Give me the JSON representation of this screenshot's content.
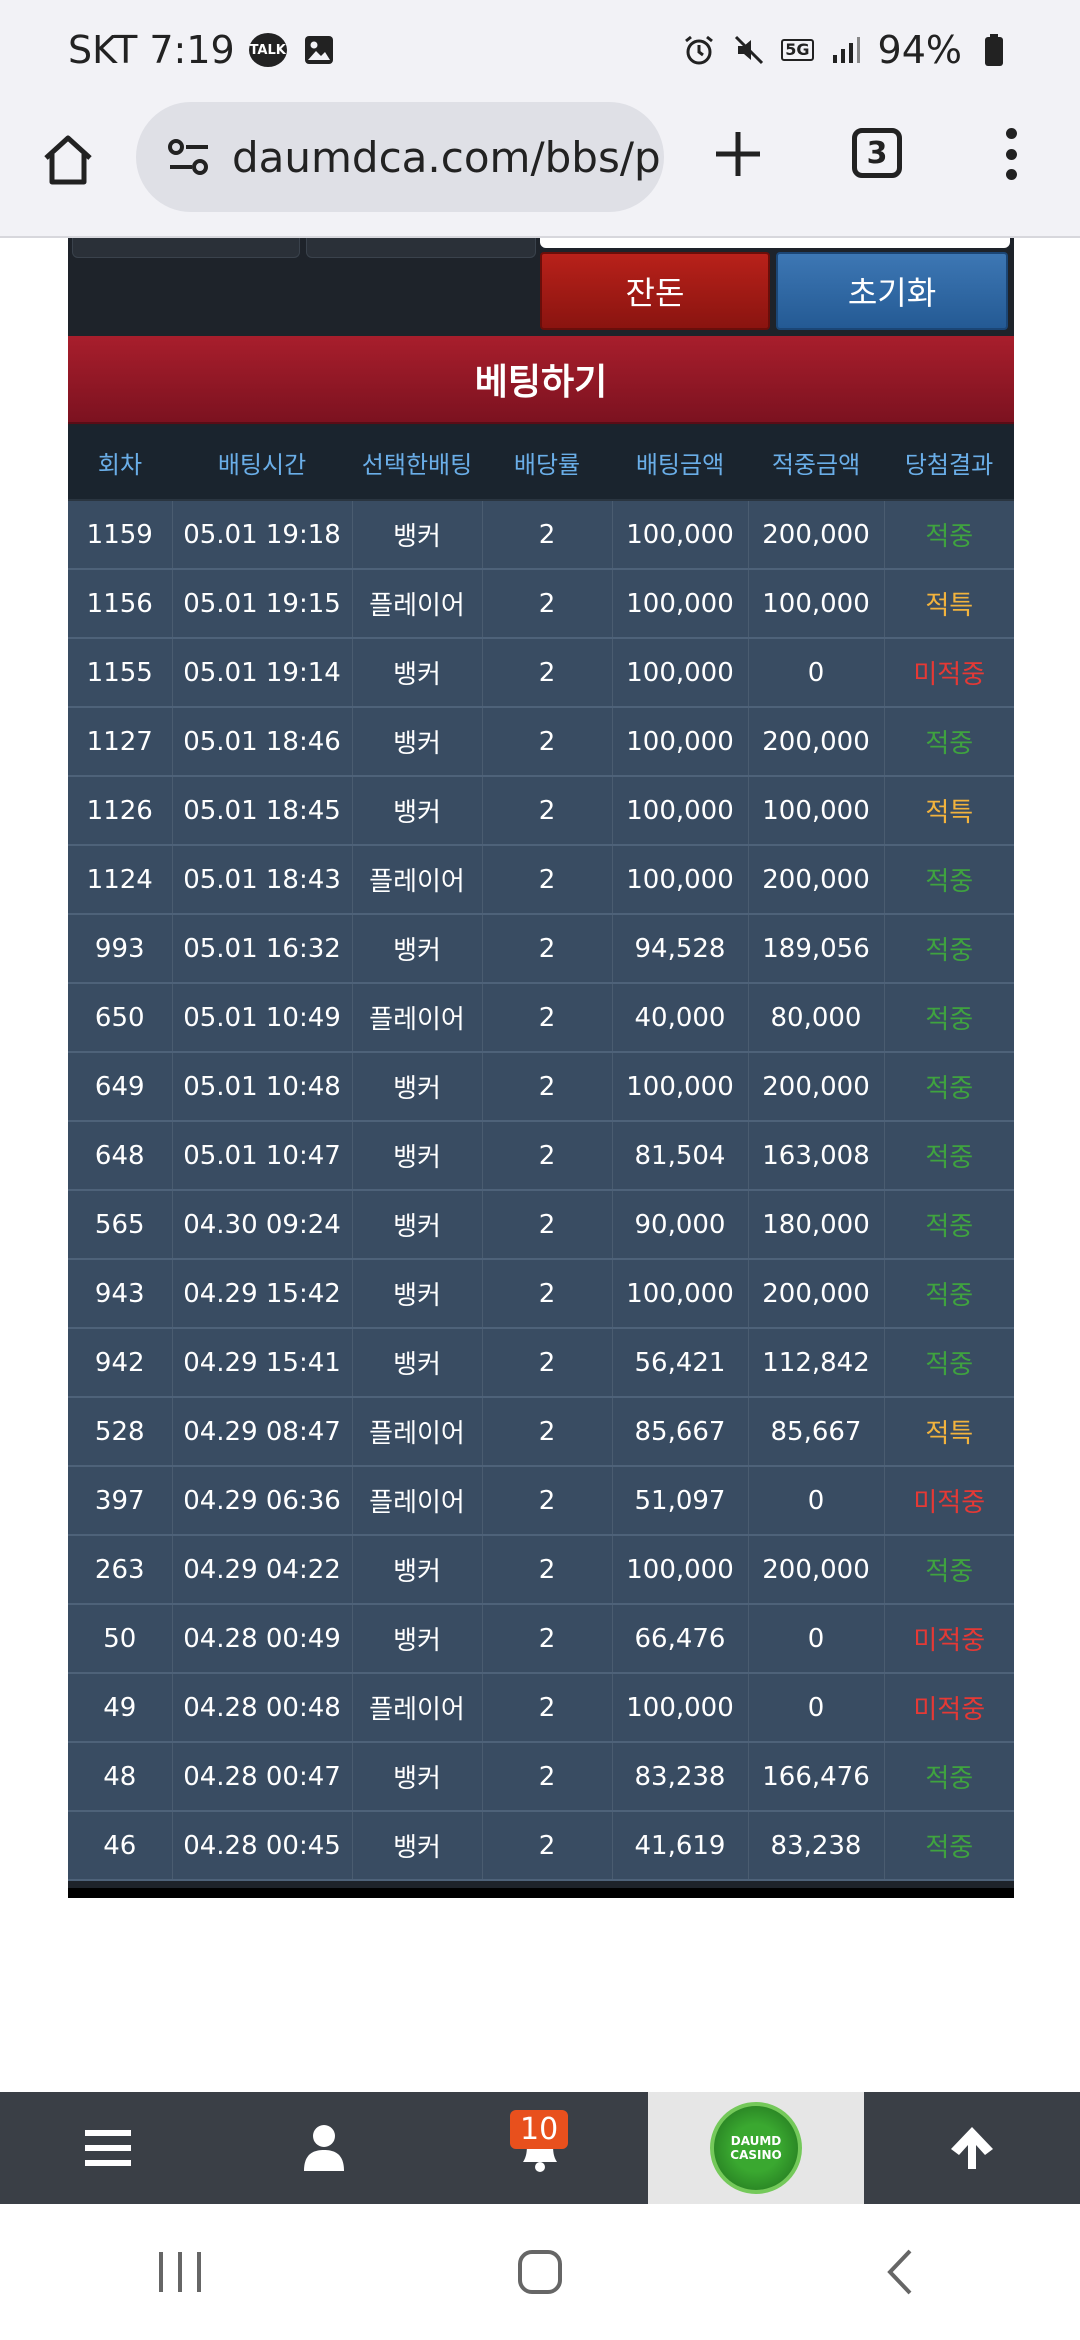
{
  "status_bar": {
    "carrier_time": "SKT 7:19",
    "talk_badge": "TALK",
    "network": "5G",
    "battery": "94%"
  },
  "browser": {
    "url": "daumdca.com/bbs/p",
    "tab_count": "3"
  },
  "panel": {
    "balance_label": "잔돈",
    "reset_label": "초기화",
    "bet_header": "베팅하기"
  },
  "table": {
    "headers": [
      "회차",
      "배팅시간",
      "선택한배팅",
      "배당률",
      "배팅금액",
      "적중금액",
      "당첨결과"
    ],
    "rows": [
      {
        "round": "1159",
        "time": "05.01 19:18",
        "pick": "뱅커",
        "odds": "2",
        "bet": "100,000",
        "payout": "200,000",
        "result": "적중",
        "status": "win"
      },
      {
        "round": "1156",
        "time": "05.01 19:15",
        "pick": "플레이어",
        "odds": "2",
        "bet": "100,000",
        "payout": "100,000",
        "result": "적특",
        "status": "push"
      },
      {
        "round": "1155",
        "time": "05.01 19:14",
        "pick": "뱅커",
        "odds": "2",
        "bet": "100,000",
        "payout": "0",
        "result": "미적중",
        "status": "lose"
      },
      {
        "round": "1127",
        "time": "05.01 18:46",
        "pick": "뱅커",
        "odds": "2",
        "bet": "100,000",
        "payout": "200,000",
        "result": "적중",
        "status": "win"
      },
      {
        "round": "1126",
        "time": "05.01 18:45",
        "pick": "뱅커",
        "odds": "2",
        "bet": "100,000",
        "payout": "100,000",
        "result": "적특",
        "status": "push"
      },
      {
        "round": "1124",
        "time": "05.01 18:43",
        "pick": "플레이어",
        "odds": "2",
        "bet": "100,000",
        "payout": "200,000",
        "result": "적중",
        "status": "win"
      },
      {
        "round": "993",
        "time": "05.01 16:32",
        "pick": "뱅커",
        "odds": "2",
        "bet": "94,528",
        "payout": "189,056",
        "result": "적중",
        "status": "win"
      },
      {
        "round": "650",
        "time": "05.01 10:49",
        "pick": "플레이어",
        "odds": "2",
        "bet": "40,000",
        "payout": "80,000",
        "result": "적중",
        "status": "win"
      },
      {
        "round": "649",
        "time": "05.01 10:48",
        "pick": "뱅커",
        "odds": "2",
        "bet": "100,000",
        "payout": "200,000",
        "result": "적중",
        "status": "win"
      },
      {
        "round": "648",
        "time": "05.01 10:47",
        "pick": "뱅커",
        "odds": "2",
        "bet": "81,504",
        "payout": "163,008",
        "result": "적중",
        "status": "win"
      },
      {
        "round": "565",
        "time": "04.30 09:24",
        "pick": "뱅커",
        "odds": "2",
        "bet": "90,000",
        "payout": "180,000",
        "result": "적중",
        "status": "win"
      },
      {
        "round": "943",
        "time": "04.29 15:42",
        "pick": "뱅커",
        "odds": "2",
        "bet": "100,000",
        "payout": "200,000",
        "result": "적중",
        "status": "win"
      },
      {
        "round": "942",
        "time": "04.29 15:41",
        "pick": "뱅커",
        "odds": "2",
        "bet": "56,421",
        "payout": "112,842",
        "result": "적중",
        "status": "win"
      },
      {
        "round": "528",
        "time": "04.29 08:47",
        "pick": "플레이어",
        "odds": "2",
        "bet": "85,667",
        "payout": "85,667",
        "result": "적특",
        "status": "push"
      },
      {
        "round": "397",
        "time": "04.29 06:36",
        "pick": "플레이어",
        "odds": "2",
        "bet": "51,097",
        "payout": "0",
        "result": "미적중",
        "status": "lose"
      },
      {
        "round": "263",
        "time": "04.29 04:22",
        "pick": "뱅커",
        "odds": "2",
        "bet": "100,000",
        "payout": "200,000",
        "result": "적중",
        "status": "win"
      },
      {
        "round": "50",
        "time": "04.28 00:49",
        "pick": "뱅커",
        "odds": "2",
        "bet": "66,476",
        "payout": "0",
        "result": "미적중",
        "status": "lose"
      },
      {
        "round": "49",
        "time": "04.28 00:48",
        "pick": "플레이어",
        "odds": "2",
        "bet": "100,000",
        "payout": "0",
        "result": "미적중",
        "status": "lose"
      },
      {
        "round": "48",
        "time": "04.28 00:47",
        "pick": "뱅커",
        "odds": "2",
        "bet": "83,238",
        "payout": "166,476",
        "result": "적중",
        "status": "win"
      },
      {
        "round": "46",
        "time": "04.28 00:45",
        "pick": "뱅커",
        "odds": "2",
        "bet": "41,619",
        "payout": "83,238",
        "result": "적중",
        "status": "win"
      }
    ]
  },
  "bottom_nav": {
    "notification_count": "10",
    "casino_logo_text": [
      "DAUMD",
      "CASINO"
    ]
  },
  "colors": {
    "win": "#3fa33f",
    "push": "#f2b33d",
    "lose": "#e53935",
    "header_text": "#6aaee8",
    "row_bg": "#394c62"
  },
  "icons": {
    "home": "home-icon",
    "site_settings": "tune-icon",
    "new_tab": "plus-icon",
    "more": "more-vertical-icon",
    "hamburger": "hamburger-menu-icon",
    "user": "user-icon",
    "bell": "bell-icon",
    "scroll_top": "arrow-up-icon"
  }
}
